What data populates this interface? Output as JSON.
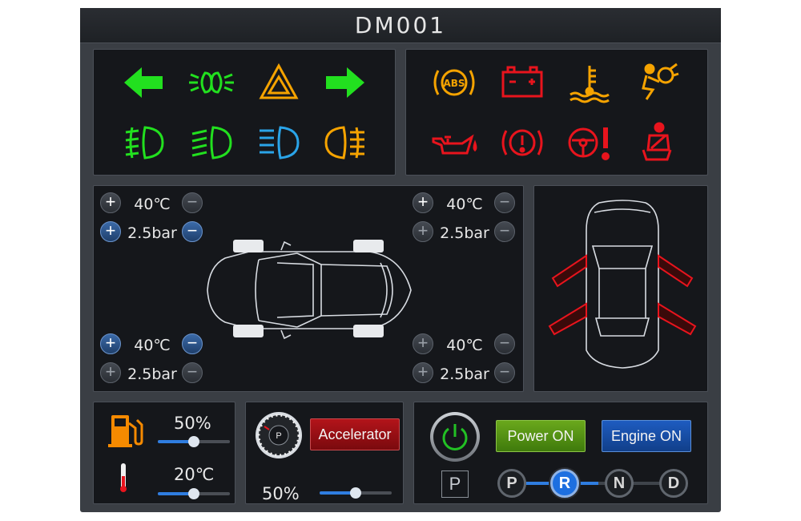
{
  "app": {
    "title": "DM001"
  },
  "tpms": {
    "front_left": {
      "temp": "40℃",
      "pressure": "2.5bar"
    },
    "front_right": {
      "temp": "40℃",
      "pressure": "2.5bar"
    },
    "rear_left": {
      "temp": "40℃",
      "pressure": "2.5bar"
    },
    "rear_right": {
      "temp": "40℃",
      "pressure": "2.5bar"
    }
  },
  "indicators": {
    "signal": [
      "turn-left-arrow-icon",
      "parking-lights-icon",
      "hazard-triangle-icon",
      "turn-right-arrow-icon",
      "front-fog-light-icon",
      "low-beam-icon",
      "high-beam-icon",
      "rear-fog-light-icon"
    ],
    "warning": [
      "abs-warning-icon",
      "battery-warning-icon",
      "coolant-temperature-icon",
      "airbag-warning-icon",
      "oil-pressure-icon",
      "brake-warning-icon",
      "steering-warning-icon",
      "seatbelt-warning-icon"
    ],
    "colors": {
      "green": "#22e01f",
      "amber": "#f5a300",
      "blue": "#2aa4e8",
      "red": "#e8141d"
    }
  },
  "fuel": {
    "level": "50%",
    "level_fraction": 0.5
  },
  "temperature": {
    "value": "20℃",
    "fraction": 0.5
  },
  "accelerator": {
    "button_label": "Accelerator",
    "value": "50%",
    "fraction": 0.5,
    "gauge_label": "P"
  },
  "power": {
    "power_on_label": "Power ON",
    "engine_on_label": "Engine ON",
    "parking_label": "P"
  },
  "gears": {
    "options": [
      "P",
      "R",
      "N",
      "D"
    ],
    "selected": "R"
  }
}
